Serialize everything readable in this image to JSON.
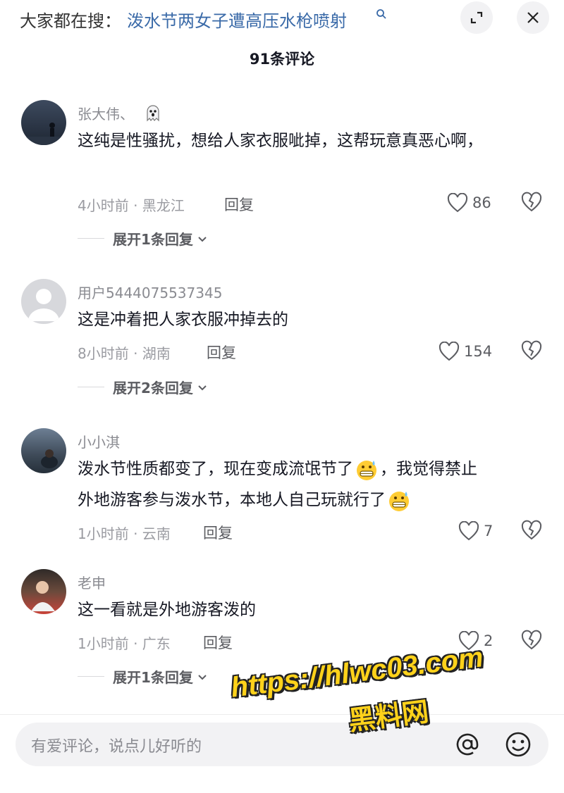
{
  "search": {
    "prefix": "大家都在搜：",
    "term": "泼水节两女子遭高压水枪喷射"
  },
  "title": "91条评论",
  "comments": [
    {
      "user": "张大伟、",
      "text": "这纯是性骚扰，想给人家衣服呲掉，这帮玩意真恶心啊，",
      "time_location": "4小时前 · 黑龙江",
      "reply": "回复",
      "likes": "86",
      "expand": "展开1条回复"
    },
    {
      "user": "用户5444075537345",
      "text": "这是冲着把人家衣服冲掉去的",
      "time_location": "8小时前 · 湖南",
      "reply": "回复",
      "likes": "154",
      "expand": "展开2条回复"
    },
    {
      "user": "小小淇",
      "text_line1": "泼水节性质都变了，现在变成流氓节了",
      "text_line1b": "，我觉得禁止",
      "text_line2": "外地游客参与泼水节，本地人自己玩就行了",
      "time_location": "1小时前 · 云南",
      "reply": "回复",
      "likes": "7"
    },
    {
      "user": "老申",
      "text": "这一看就是外地游客泼的",
      "time_location": "1小时前 · 广东",
      "reply": "回复",
      "likes": "2",
      "expand": "展开1条回复"
    }
  ],
  "input": {
    "placeholder": "有爱评论，说点儿好听的"
  },
  "watermark": {
    "url": "https://hlwc03.com",
    "name": "黑料网"
  },
  "colors": {
    "link": "#3a6aa8",
    "text": "#161823",
    "meta": "#9a9ba1",
    "watermark": "#ffd21a"
  }
}
